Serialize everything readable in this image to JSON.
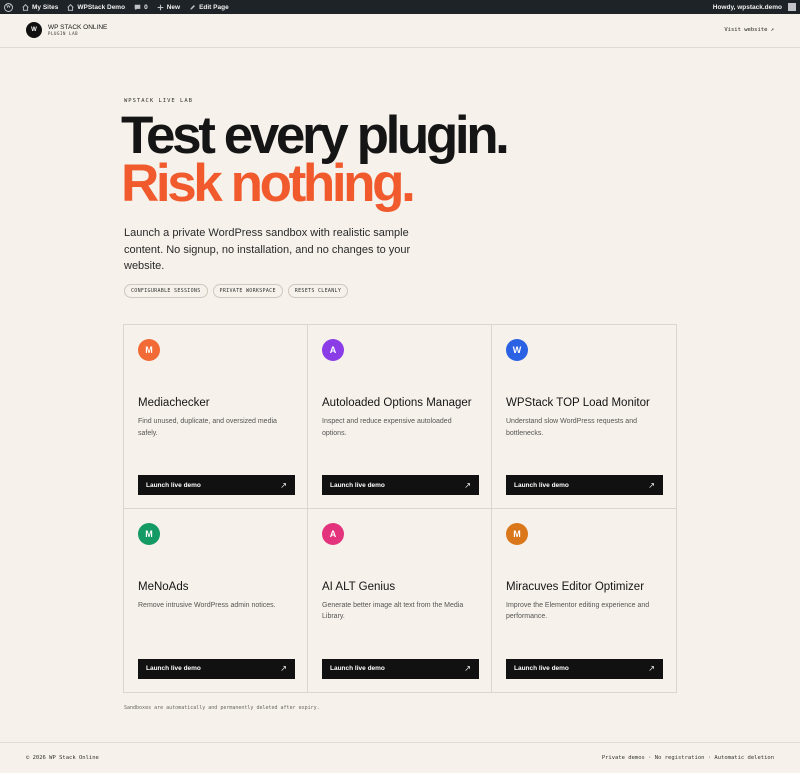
{
  "adminbar": {
    "my_sites": "My Sites",
    "site_name": "WPStack Demo",
    "comments_count": "0",
    "new_label": "New",
    "edit_page": "Edit Page",
    "howdy": "Howdy, wpstack.demo"
  },
  "header": {
    "logo_letter": "W",
    "brand": "WP STACK ONLINE",
    "brand_sub": "PLUGIN LAB",
    "visit_label": "Visit website ↗"
  },
  "hero": {
    "eyebrow": "WPSTACK LIVE LAB",
    "title_line1": "Test every plugin.",
    "title_line2": "Risk nothing.",
    "lede": "Launch a private WordPress sandbox with realistic sample content. No signup, no installation, and no changes to your website.",
    "tags": [
      "CONFIGURABLE SESSIONS",
      "PRIVATE WORKSPACE",
      "RESETS CLEANLY"
    ]
  },
  "plugins": [
    {
      "letter": "M",
      "color": "#f26a35",
      "title": "Mediachecker",
      "desc": "Find unused, duplicate, and oversized media safely.",
      "button": "Launch live demo"
    },
    {
      "letter": "A",
      "color": "#8a3de6",
      "title": "Autoloaded Options Manager",
      "desc": "Inspect and reduce expensive autoloaded options.",
      "button": "Launch live demo"
    },
    {
      "letter": "W",
      "color": "#2b62e3",
      "title": "WPStack TOP Load Monitor",
      "desc": "Understand slow WordPress requests and bottlenecks.",
      "button": "Launch live demo"
    },
    {
      "letter": "M",
      "color": "#149a63",
      "title": "MeNoAds",
      "desc": "Remove intrusive WordPress admin notices.",
      "button": "Launch live demo"
    },
    {
      "letter": "A",
      "color": "#e2337c",
      "title": "AI ALT Genius",
      "desc": "Generate better image alt text from the Media Library.",
      "button": "Launch live demo"
    },
    {
      "letter": "M",
      "color": "#d9771a",
      "title": "Miracuves Editor Optimizer",
      "desc": "Improve the Elementor editing experience and performance.",
      "button": "Launch live demo"
    }
  ],
  "note": "Sandboxes are automatically and permanently deleted after expiry.",
  "footer": {
    "copyright": "© 2026 WP Stack Online",
    "right": "Private demos · No registration · Automatic deletion"
  }
}
